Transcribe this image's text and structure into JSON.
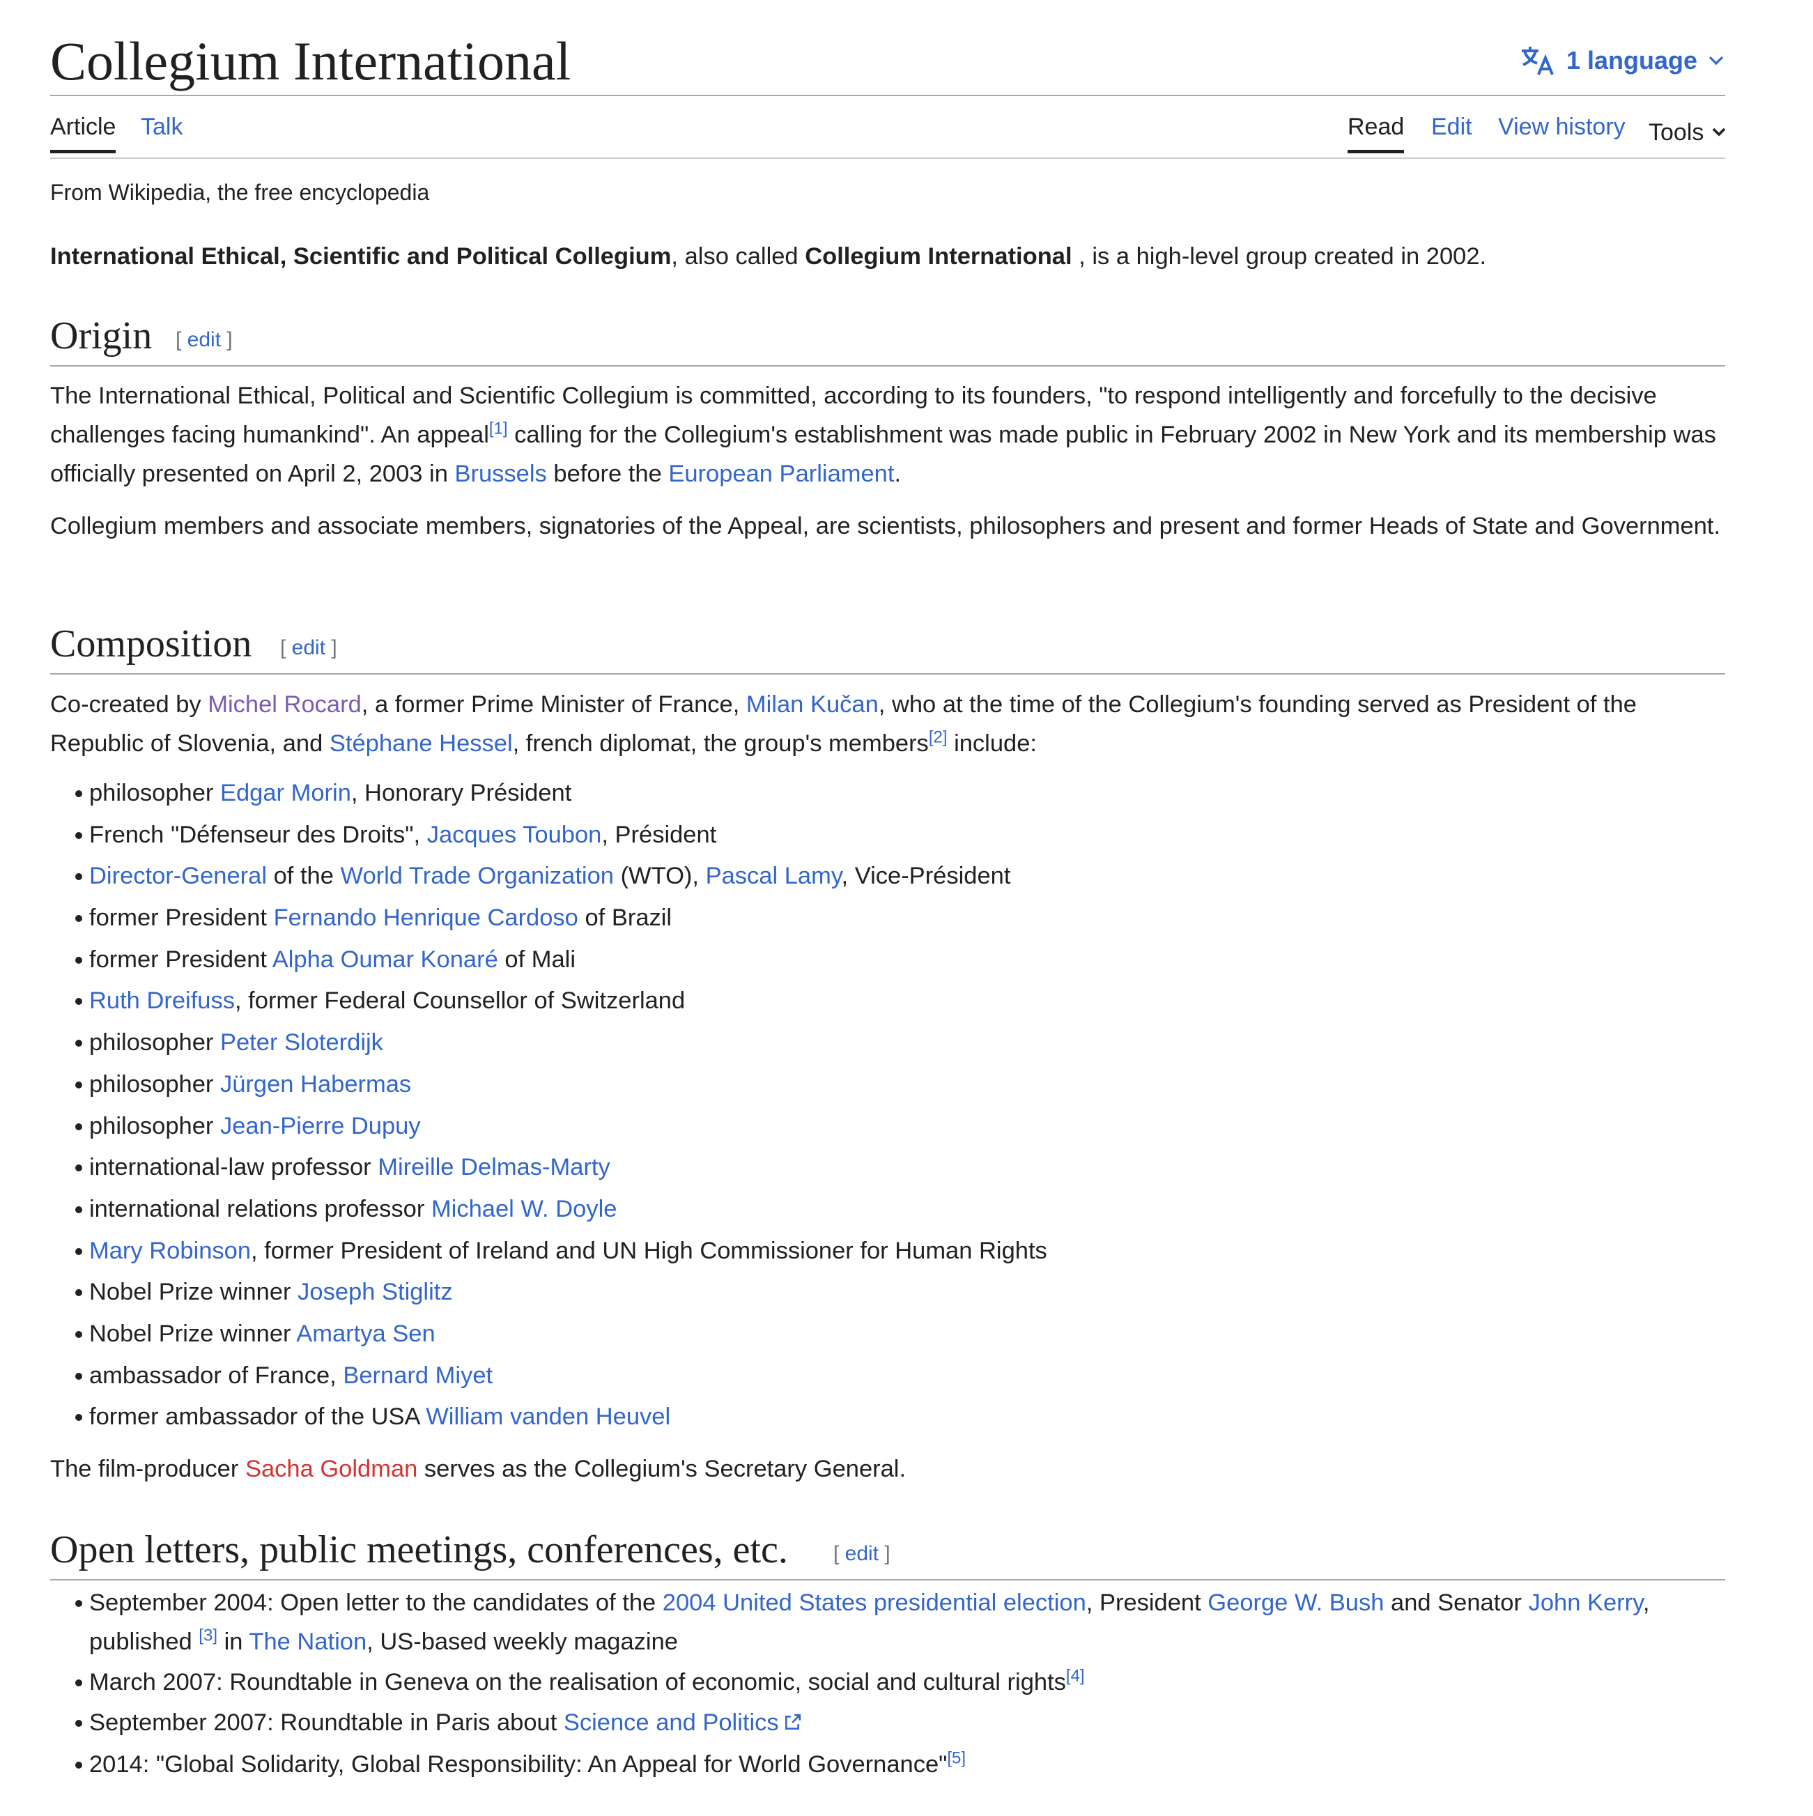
{
  "title": "Collegium International",
  "language_button": {
    "icon": "translate-icon",
    "label": "1 language"
  },
  "tabs": {
    "article": "Article",
    "talk": "Talk",
    "read": "Read",
    "edit": "Edit",
    "history": "View history",
    "tools": "Tools"
  },
  "tagline": "From Wikipedia, the free encyclopedia",
  "edit_link": "edit",
  "intro": {
    "bold1": "International Ethical, Scientific and Political Collegium",
    "t1": ", also called ",
    "bold2": "Collegium International",
    "t2": " , is a high-level group created in 2002."
  },
  "sections": {
    "origin": {
      "heading": "Origin",
      "p1": {
        "t1": "The International Ethical, Political and Scientific Collegium is committed, according to its founders, \"to respond intelligently and forcefully to the decisive challenges facing humankind\". An appeal",
        "ref": "[1]",
        "t2": " calling for the Collegium's establishment was made public in February 2002 in New York and its membership was officially presented on April 2, 2003 in ",
        "link1": "Brussels",
        "t3": " before the ",
        "link2": "European Parliament",
        "t4": "."
      },
      "p2": "Collegium members and associate members, signatories of the Appeal, are scientists, philosophers and present and former Heads of State and Government."
    },
    "composition": {
      "heading": "Composition",
      "p1": {
        "t1": "Co-created by ",
        "link1": "Michel Rocard",
        "t2": ", a former Prime Minister of France, ",
        "link2": "Milan Kučan",
        "t3": ", who at the time of the Collegium's founding served as President of the Republic of Slovenia, and ",
        "link3": "Stéphane Hessel",
        "t4": ", french diplomat, the group's members",
        "ref": "[2]",
        "t5": " include:"
      },
      "members": [
        {
          "pre": "philosopher ",
          "link": "Edgar Morin",
          "post": ", Honorary Président"
        },
        {
          "pre": "French \"Défenseur des Droits\", ",
          "link": "Jacques Toubon",
          "post": ", Président"
        },
        {
          "link_a": "Director-General",
          "mid1": " of the ",
          "link_b": "World Trade Organization",
          "mid2": " (WTO), ",
          "link_c": "Pascal Lamy",
          "post": ", Vice-Président"
        },
        {
          "pre": "former President ",
          "link": "Fernando Henrique Cardoso",
          "post": " of Brazil"
        },
        {
          "pre": "former President ",
          "link": "Alpha Oumar Konaré",
          "post": " of Mali"
        },
        {
          "pre": "",
          "link": "Ruth Dreifuss",
          "post": ", former Federal Counsellor of Switzerland"
        },
        {
          "pre": "philosopher ",
          "link": "Peter Sloterdijk",
          "post": ""
        },
        {
          "pre": "philosopher ",
          "link": "Jürgen Habermas",
          "post": ""
        },
        {
          "pre": "philosopher ",
          "link": "Jean-Pierre Dupuy",
          "post": ""
        },
        {
          "pre": "international-law professor ",
          "link": "Mireille Delmas-Marty",
          "post": ""
        },
        {
          "pre": "international relations professor ",
          "link": "Michael W. Doyle",
          "post": ""
        },
        {
          "pre": "",
          "link": "Mary Robinson",
          "post": ", former President of Ireland and UN High Commissioner for Human Rights"
        },
        {
          "pre": "Nobel Prize winner ",
          "link": "Joseph Stiglitz",
          "post": ""
        },
        {
          "pre": "Nobel Prize winner ",
          "link": "Amartya Sen",
          "post": ""
        },
        {
          "pre": "ambassador of France, ",
          "link": "Bernard Miyet",
          "post": ""
        },
        {
          "pre": "former ambassador of the USA ",
          "link": "William vanden Heuvel",
          "post": ""
        }
      ],
      "closing": {
        "t1": "The film-producer ",
        "redlink": "Sacha Goldman",
        "t2": " serves as the Collegium's Secretary General."
      }
    },
    "open_letters": {
      "heading": "Open letters, public meetings, conferences, etc.",
      "items": [
        {
          "t1": "September 2004: Open letter to the candidates of the ",
          "l1": "2004 United States presidential election",
          "t2": ", President ",
          "l2": "George W. Bush",
          "t3": " and Senator ",
          "l3": "John Kerry",
          "t4": ", published ",
          "ref": "[3]",
          "t5": " in ",
          "l4": "The Nation",
          "t6": ", US-based weekly magazine"
        },
        {
          "t1": "March 2007: Roundtable in Geneva on the realisation of economic, social and cultural rights",
          "ref": "[4]"
        },
        {
          "t1": "September 2007: Roundtable in Paris about ",
          "l1": "Science and Politics",
          "icon": "external-link-icon"
        },
        {
          "t1": "2014: \"Global Solidarity, Global Responsibility: An Appeal for World Governance\"",
          "ref": "[5]"
        }
      ]
    }
  },
  "colors": {
    "link": "#3366cc",
    "visited": "#795cb2",
    "redlink": "#d73333",
    "text": "#202122"
  }
}
